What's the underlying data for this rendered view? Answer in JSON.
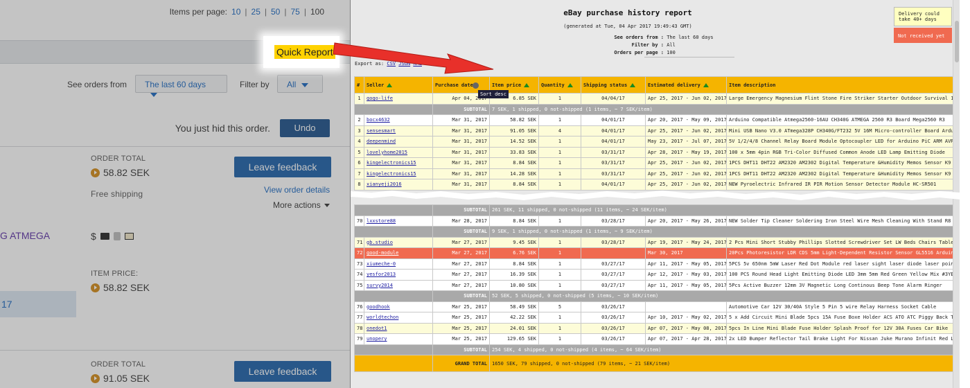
{
  "ebay_page": {
    "items_per_page": {
      "label": "Items per page:",
      "options": [
        "10",
        "25",
        "50",
        "75",
        "100"
      ],
      "current": "100"
    },
    "quick_report": "Quick Report",
    "filters": {
      "see_orders_label": "See orders from",
      "see_orders_value": "The last 60 days",
      "filter_by_label": "Filter by",
      "filter_by_value": "All"
    },
    "hidden": {
      "message": "You just hid this order.",
      "undo": "Undo"
    },
    "order1": {
      "total_label": "ORDER TOTAL",
      "total": "58.82 SEK",
      "leave_feedback": "Leave feedback",
      "shipping": "Free shipping",
      "view_details": "View order details",
      "more_actions": "More actions",
      "title_fragment": "G ATMEGA",
      "item_price_label": "ITEM PRICE:",
      "item_price": "58.82 SEK",
      "year_fragment": "17",
      "dollar": "$"
    },
    "order2": {
      "total_label": "ORDER TOTAL",
      "total": "91.05 SEK",
      "leave_feedback": "Leave feedback"
    }
  },
  "report": {
    "title": "eBay purchase history report",
    "generated": "(generated at Tue, 04 Apr 2017 19:49:43 GMT)",
    "meta": [
      {
        "k": "See orders from :",
        "v": "The last 60 days"
      },
      {
        "k": "Filter by :",
        "v": "All"
      },
      {
        "k": "Orders per page :",
        "v": "100"
      }
    ],
    "note_yellow": "Delivery could take 40+ days",
    "note_red": "Not received yet",
    "export": {
      "label": "Export as:",
      "csv": "CSV",
      "json": "JSON",
      "xml": "XML"
    },
    "sort_tooltip": "Sort desc",
    "columns": [
      "#",
      "Seller",
      "Purchase date",
      "Item price",
      "Quantity",
      "Shipping status",
      "Estimated delivery",
      "Item description"
    ],
    "rows_top": [
      {
        "n": "1",
        "seller": "gogo-life",
        "date": "Apr 04, 2017",
        "price": "6.85 SEK",
        "qty": "1",
        "ship": "04/04/17",
        "est": "Apr 25, 2017 - Jun 02, 2017",
        "desc": "Large Emergency Magnesium Flint Stone Fire Striker Starter Outdoor Survival 10cm",
        "style": "y"
      },
      {
        "sub": true,
        "text": "7 SEK, 1 shipped, 0 not-shipped (1 items, ~ 7 SEK/item)"
      },
      {
        "n": "2",
        "seller": "bocx4632",
        "date": "Mar 31, 2017",
        "price": "58.82 SEK",
        "qty": "1",
        "ship": "04/01/17",
        "est": "Apr 20, 2017 - May 09, 2017",
        "desc": "Arduino Compatible Atmega2560-16AU CH340G ATMEGA 2560 R3 Board Mega2560 R3",
        "style": "w"
      },
      {
        "n": "3",
        "seller": "sensesmart",
        "date": "Mar 31, 2017",
        "price": "91.05 SEK",
        "qty": "4",
        "ship": "04/01/17",
        "est": "Apr 25, 2017 - Jun 02, 2017",
        "desc": "Mini USB Nano V3.0 ATmega328P CH340G/FT232 5V 16M Micro-controller Board Arduino",
        "style": "y"
      },
      {
        "n": "4",
        "seller": "deepenmind",
        "date": "Mar 31, 2017",
        "price": "14.52 SEK",
        "qty": "1",
        "ship": "04/01/17",
        "est": "May 23, 2017 - Jul 07, 2017",
        "desc": "5V 1/2/4/8 Channel Relay Board Module Optocoupler LED for Arduino PiC ARM AVRC",
        "style": "y"
      },
      {
        "n": "5",
        "seller": "lovelyhome2015",
        "date": "Mar 31, 2017",
        "price": "33.83 SEK",
        "qty": "1",
        "ship": "03/31/17",
        "est": "Apr 28, 2017 - May 19, 2017",
        "desc": "100 x 5mm 4pin RGB Tri-Color Diffused Common Anode LED Lamp Emitting Diode",
        "style": "y"
      },
      {
        "n": "6",
        "seller": "kingelectronics15",
        "date": "Mar 31, 2017",
        "price": "8.84 SEK",
        "qty": "1",
        "ship": "03/31/17",
        "est": "Apr 25, 2017 - Jun 02, 2017",
        "desc": "1PCS DHT11 DHT22 AM2320 AM2302 Digital Temperature &Humidity Memos Sensor K9",
        "style": "y"
      },
      {
        "n": "7",
        "seller": "kingelectronics15",
        "date": "Mar 31, 2017",
        "price": "14.28 SEK",
        "qty": "1",
        "ship": "03/31/17",
        "est": "Apr 25, 2017 - Jun 02, 2017",
        "desc": "1PCS DHT11 DHT22 AM2320 AM2302 Digital Temperature &Humidity Memos Sensor K9",
        "style": "y"
      },
      {
        "n": "8",
        "seller": "xianyeji2016",
        "date": "Mar 31, 2017",
        "price": "8.84 SEK",
        "qty": "1",
        "ship": "04/01/17",
        "est": "Apr 25, 2017 - Jun 02, 2017",
        "desc": "NEW Pyroelectric Infrared IR PIR Motion Sensor Detector Module HC-SR501",
        "style": "y"
      }
    ],
    "rows_bottom": [
      {
        "sub": true,
        "text": "261 SEK, 11 shipped, 0 not-shipped (11 items, ~ 24 SEK/item)"
      },
      {
        "n": "70",
        "seller": "lxxstore88",
        "date": "Mar 28, 2017",
        "price": "8.84 SEK",
        "qty": "1",
        "ship": "03/28/17",
        "est": "Apr 20, 2017 - May 26, 2017",
        "desc": "NEW Solder Tip Cleaner Soldering Iron Steel Wire Mesh Cleaning With Stand R8",
        "style": "w"
      },
      {
        "sub": true,
        "text": "9 SEK, 1 shipped, 0 not-shipped (1 items, ~ 9 SEK/item)"
      },
      {
        "n": "71",
        "seller": "gb.studio",
        "date": "Mar 27, 2017",
        "price": "9.45 SEK",
        "qty": "1",
        "ship": "03/28/17",
        "est": "Apr 19, 2017 - May 24, 2017",
        "desc": "2 Pcs Mini Short Stubby Phillips Slotted Screwdriver Set LW Beds Chairs Tables",
        "style": "y"
      },
      {
        "n": "72",
        "seller": "good-module",
        "date": "Mar 27, 2017",
        "price": "6.76 SEK",
        "qty": "1",
        "ship": "",
        "est": "Mar 30, 2017",
        "desc": "20Pcs Photoresistor LDR CDS 5mm Light-Dependent Resistor Sensor GL5516 Arduino",
        "style": "r"
      },
      {
        "n": "73",
        "seller": "xiumeche-0",
        "date": "Mar 27, 2017",
        "price": "8.84 SEK",
        "qty": "1",
        "ship": "03/27/17",
        "est": "Apr 11, 2017 - May 05, 2017",
        "desc": "5PCS 5v 650nm 5mW Laser Red Dot Module red laser sight laser diode laser pointer",
        "style": "w"
      },
      {
        "n": "74",
        "seller": "yesfor2013",
        "date": "Mar 27, 2017",
        "price": "16.39 SEK",
        "qty": "1",
        "ship": "03/27/17",
        "est": "Apr 12, 2017 - May 03, 2017",
        "desc": "100 PCS Round Head Light Emitting Diode LED 3mm 5mm Red Green Yellow Mix #3YE",
        "style": "w"
      },
      {
        "n": "75",
        "seller": "survy2014",
        "date": "Mar 27, 2017",
        "price": "10.80 SEK",
        "qty": "1",
        "ship": "03/27/17",
        "est": "Apr 11, 2017 - May 05, 2017",
        "desc": "5Pcs Active Buzzer 12mm 3V Magnetic Long Continous Beep Tone Alarm Ringer",
        "style": "w"
      },
      {
        "sub": true,
        "text": "52 SEK, 5 shipped, 0 not-shipped (5 items, ~ 10 SEK/item)"
      },
      {
        "n": "76",
        "seller": "goodhook",
        "date": "Mar 25, 2017",
        "price": "58.49 SEK",
        "qty": "5",
        "ship": "03/26/17",
        "est": "",
        "desc": "Automotive Car 12V 30/40A Style 5 Pin 5 wire Relay Harness Socket Cable",
        "style": "w"
      },
      {
        "n": "77",
        "seller": "worldtechon",
        "date": "Mar 25, 2017",
        "price": "42.22 SEK",
        "qty": "1",
        "ship": "03/26/17",
        "est": "Apr 10, 2017 - May 02, 2017",
        "desc": "5 x Add Circuit Mini Blade 5pcs 15A Fuse Boxe Holder ACS ATO ATC Piggy Back Tap",
        "style": "w"
      },
      {
        "n": "78",
        "seller": "onedot1",
        "date": "Mar 25, 2017",
        "price": "24.01 SEK",
        "qty": "1",
        "ship": "03/26/17",
        "est": "Apr 07, 2017 - May 08, 2017",
        "desc": "5pcs In Line Mini Blade Fuse Holder Splash Proof for 12V 30A Fuses Car Bike",
        "style": "y"
      },
      {
        "n": "79",
        "seller": "unopery",
        "date": "Mar 25, 2017",
        "price": "129.65 SEK",
        "qty": "1",
        "ship": "03/26/17",
        "est": "Apr 07, 2017 - Apr 28, 2017",
        "desc": "2x LED Bumper Reflector Tail Brake Light For Nissan Juke Murano Infinit Red Lens",
        "style": "w"
      },
      {
        "sub": true,
        "text": "254 SEK, 4 shipped, 0 not-shipped (4 items, ~ 64 SEK/item)"
      }
    ],
    "subtotal_label": "SUBTOTAL",
    "grand_label": "GRAND TOTAL",
    "grand_text": "1650 SEK, 79 shipped, 0 not-shipped (79 items, ~ 21 SEK/item)"
  }
}
